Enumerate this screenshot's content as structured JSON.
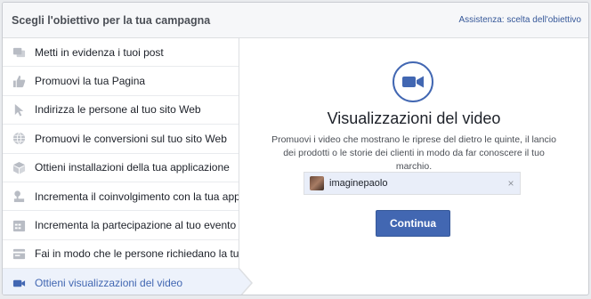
{
  "header": {
    "title": "Scegli l'obiettivo per la tua campagna",
    "help_link": "Assistenza: scelta dell'obiettivo"
  },
  "sidebar": {
    "items": [
      {
        "label": "Metti in evidenza i tuoi post",
        "icon": "post-icon"
      },
      {
        "label": "Promuovi la tua Pagina",
        "icon": "thumbs-up-icon"
      },
      {
        "label": "Indirizza le persone al tuo sito Web",
        "icon": "cursor-icon"
      },
      {
        "label": "Promuovi le conversioni sul tuo sito Web",
        "icon": "globe-icon"
      },
      {
        "label": "Ottieni installazioni della tua applicazione",
        "icon": "box-icon"
      },
      {
        "label": "Incrementa il coinvolgimento con la tua applicazione",
        "icon": "joystick-icon"
      },
      {
        "label": "Incrementa la partecipazione al tuo evento",
        "icon": "calendar-icon"
      },
      {
        "label": "Fai in modo che le persone richiedano la tua offerta",
        "icon": "offer-icon"
      },
      {
        "label": "Ottieni visualizzazioni del video",
        "icon": "video-camera-icon",
        "active": true
      }
    ]
  },
  "main": {
    "icon": "video-camera-icon",
    "title": "Visualizzazioni del video",
    "description": "Promuovi i video che mostrano le riprese del dietro le quinte, il lancio dei prodotti o le storie dei clienti in modo da far conoscere il tuo marchio.",
    "page_selector": {
      "name": "imaginepaolo",
      "clear": "×"
    },
    "continue_label": "Continua"
  },
  "colors": {
    "accent": "#4267b2",
    "active_bg": "#edf2fb",
    "header_bg": "#f6f7f9"
  }
}
